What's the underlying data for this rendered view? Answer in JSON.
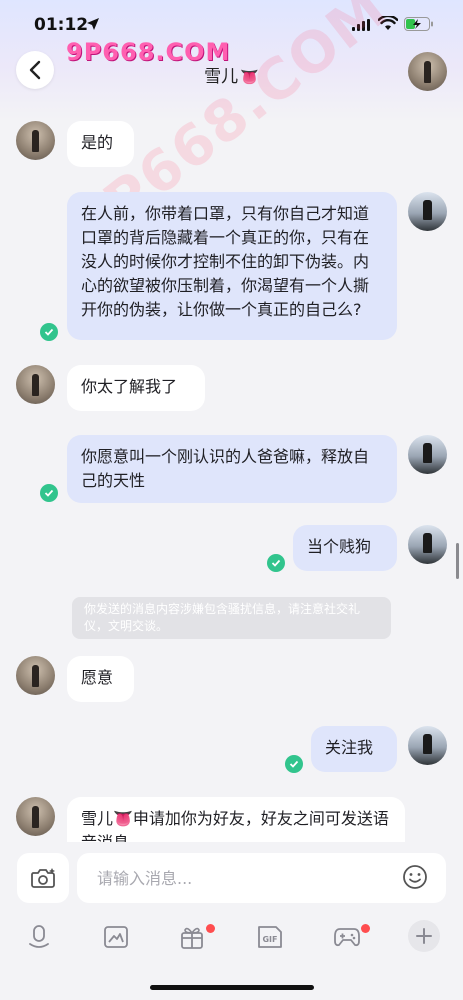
{
  "status_bar": {
    "time": "01:12"
  },
  "watermark": {
    "text": "9P668.COM",
    "diag_text": "9P668.COM"
  },
  "header": {
    "title": "雪儿",
    "title_emoji": "👅"
  },
  "messages": [
    {
      "side": "in",
      "text": "是的"
    },
    {
      "side": "out",
      "text": "在人前，你带着口罩，只有你自己才知道口罩的背后隐藏着一个真正的你，只有在没人的时候你才控制不住的卸下伪装。内心的欲望被你压制着，你渴望有一个人撕开你的伪装，让你做一个真正的自己么?"
    },
    {
      "side": "in",
      "text": "你太了解我了"
    },
    {
      "side": "out",
      "text": "你愿意叫一个刚认识的人爸爸嘛，释放自己的天性"
    },
    {
      "side": "out",
      "text": "当个贱狗"
    },
    {
      "side": "system",
      "text": "你发送的消息内容涉嫌包含骚扰信息，请注意社交礼仪，文明交谈。"
    },
    {
      "side": "in",
      "text": "愿意"
    },
    {
      "side": "out",
      "text": "关注我"
    },
    {
      "side": "in",
      "text": "雪儿👅申请加你为好友，好友之间可发送语音消息"
    }
  ],
  "input": {
    "placeholder": "请输入消息..."
  },
  "toolbar": {
    "gif_label": "GIF",
    "badges": [
      "gift",
      "game"
    ]
  },
  "colors": {
    "out_bubble": "#dfe5fb",
    "in_bubble": "#ffffff",
    "check": "#31c48d",
    "badge": "#ff4d4f"
  }
}
